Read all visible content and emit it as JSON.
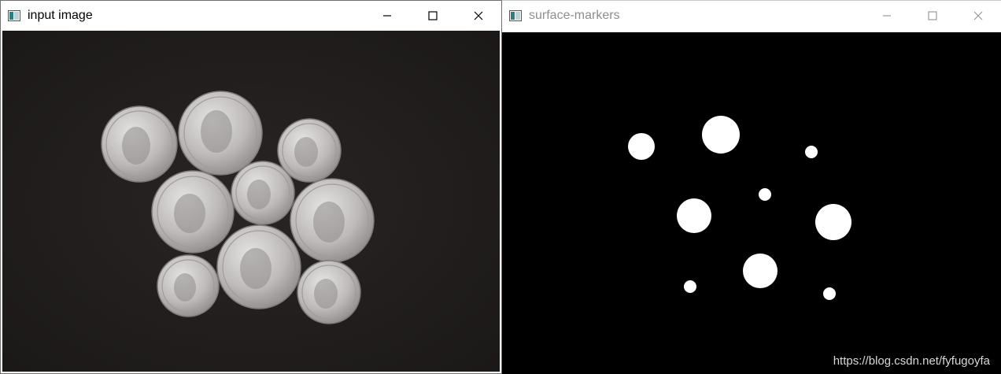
{
  "windows": [
    {
      "title": "input image",
      "active": true,
      "controls": [
        "minimize-icon",
        "maximize-icon",
        "close-icon"
      ]
    },
    {
      "title": "surface-markers",
      "active": false,
      "controls": [
        "minimize-icon",
        "maximize-icon",
        "close-icon"
      ]
    }
  ],
  "watermark": "https://blog.csdn.net/fyfugoyfa",
  "colors": {
    "photo_background": "#201c1c",
    "coin": "#c9c7c6",
    "mask_background": "#000000",
    "marker": "#ffffff"
  }
}
